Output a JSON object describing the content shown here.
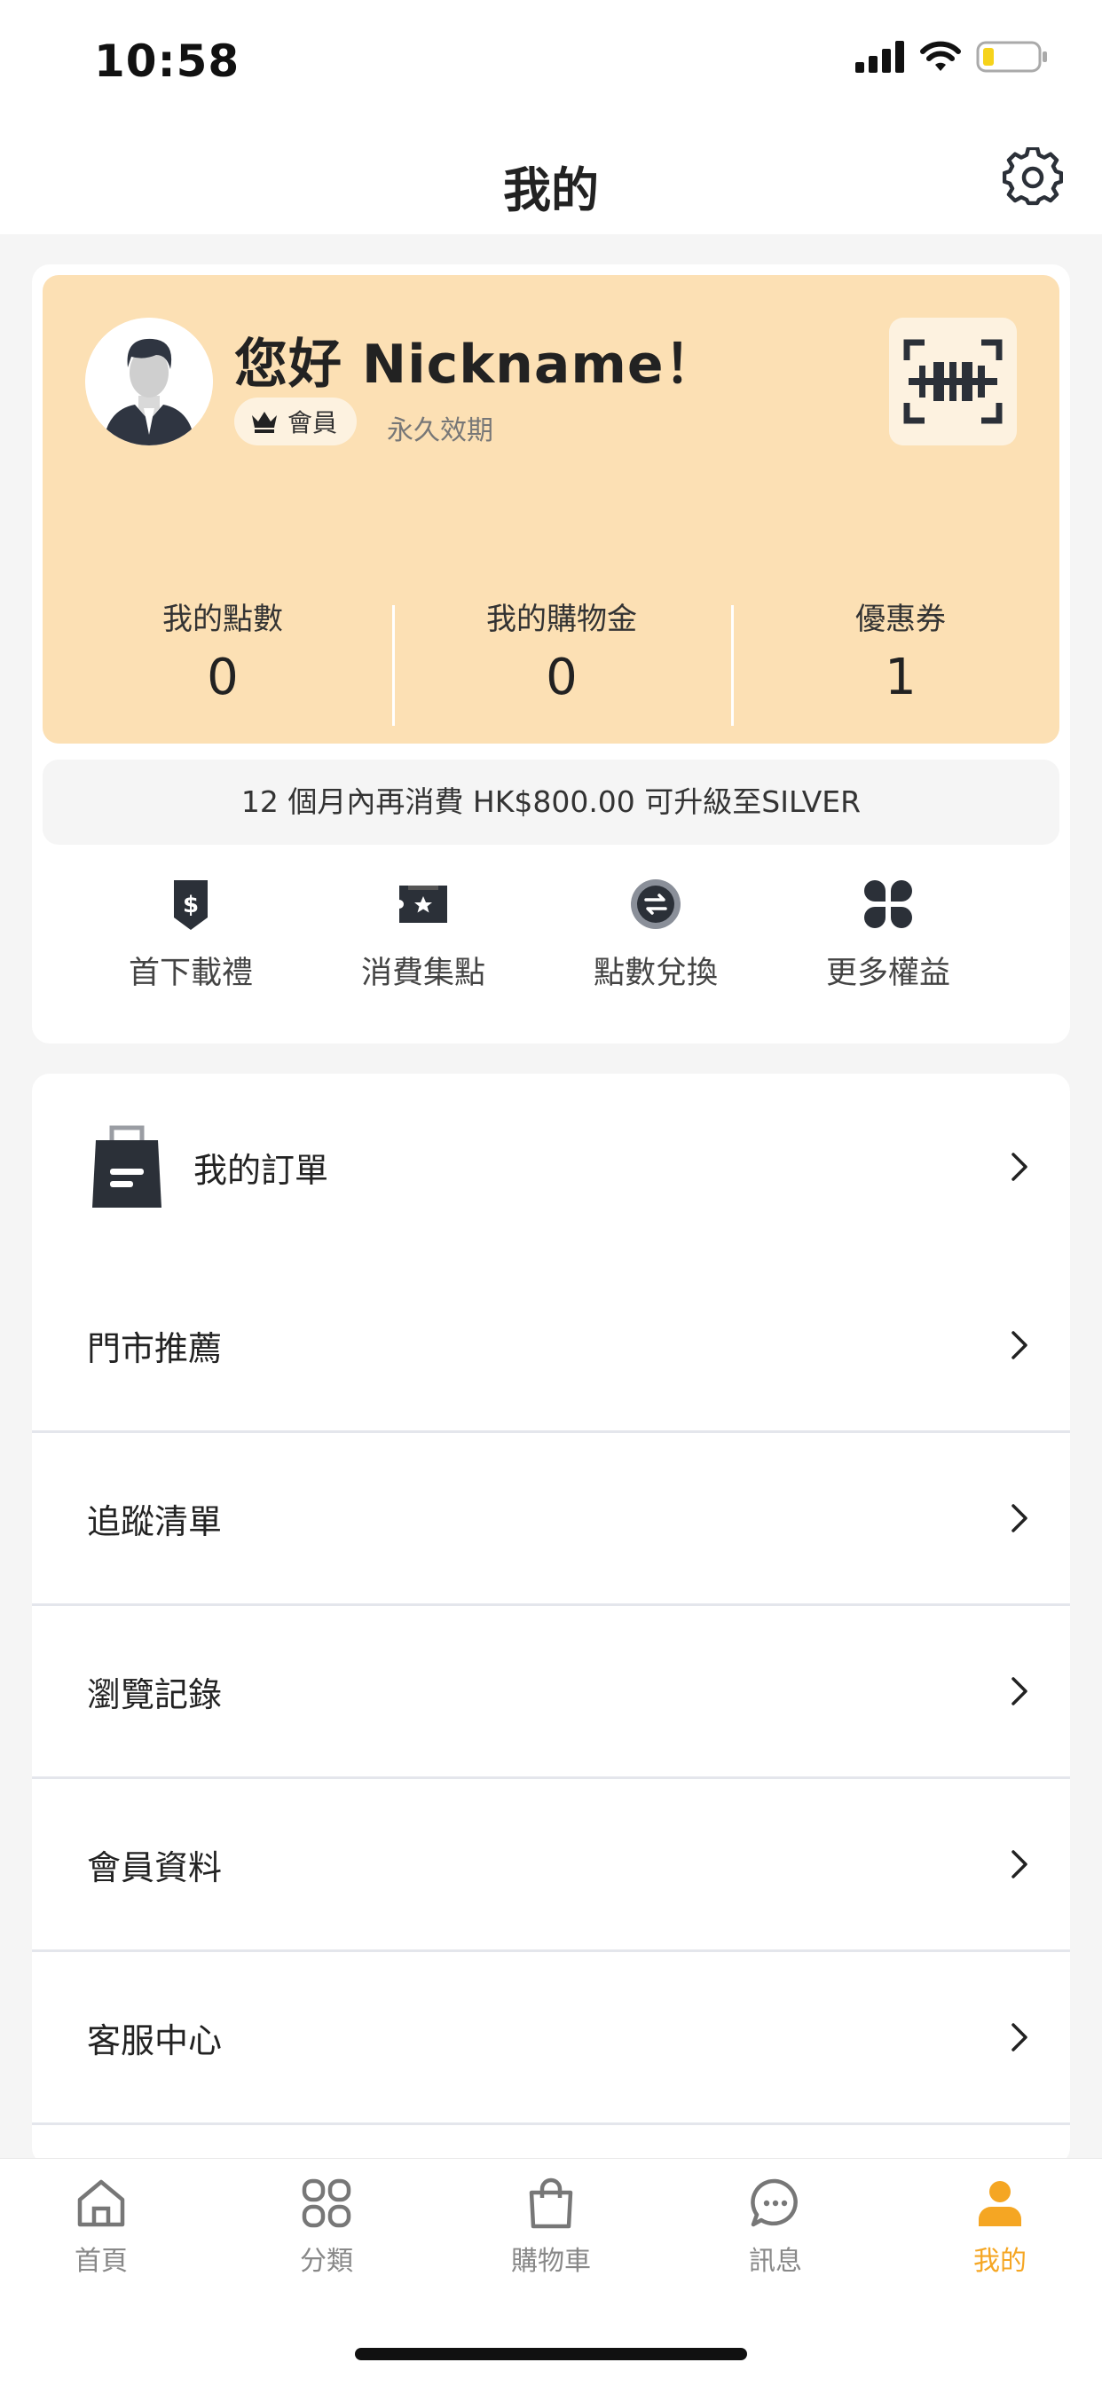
{
  "status_bar": {
    "time": "10:58"
  },
  "nav": {
    "title": "我的"
  },
  "member": {
    "greeting": "您好 Nickname！",
    "tier": "會員",
    "validity": "永久效期",
    "stats": [
      {
        "label": "我的點數",
        "value": "0"
      },
      {
        "label": "我的購物金",
        "value": "0"
      },
      {
        "label": "優惠券",
        "value": "1"
      }
    ],
    "upgrade_text": "12 個月內再消費 HK$800.00 可升級至SILVER"
  },
  "benefits": [
    {
      "label": "首下載禮",
      "icon": "download-gift-icon"
    },
    {
      "label": "消費集點",
      "icon": "ticket-star-icon"
    },
    {
      "label": "點數兌換",
      "icon": "exchange-icon"
    },
    {
      "label": "更多權益",
      "icon": "more-benefits-icon"
    }
  ],
  "menu": {
    "orders": "我的訂單",
    "items": [
      "門市推薦",
      "追蹤清單",
      "瀏覽記錄",
      "會員資料",
      "客服中心"
    ]
  },
  "tabbar": [
    {
      "label": "首頁",
      "icon": "home-icon"
    },
    {
      "label": "分類",
      "icon": "category-icon"
    },
    {
      "label": "購物車",
      "icon": "shopping-bag-icon"
    },
    {
      "label": "訊息",
      "icon": "message-icon"
    },
    {
      "label": "我的",
      "icon": "profile-icon",
      "active": true
    }
  ],
  "colors": {
    "accent": "#f5a623",
    "card": "#fce0b4",
    "dark_icon": "#2b3038"
  }
}
